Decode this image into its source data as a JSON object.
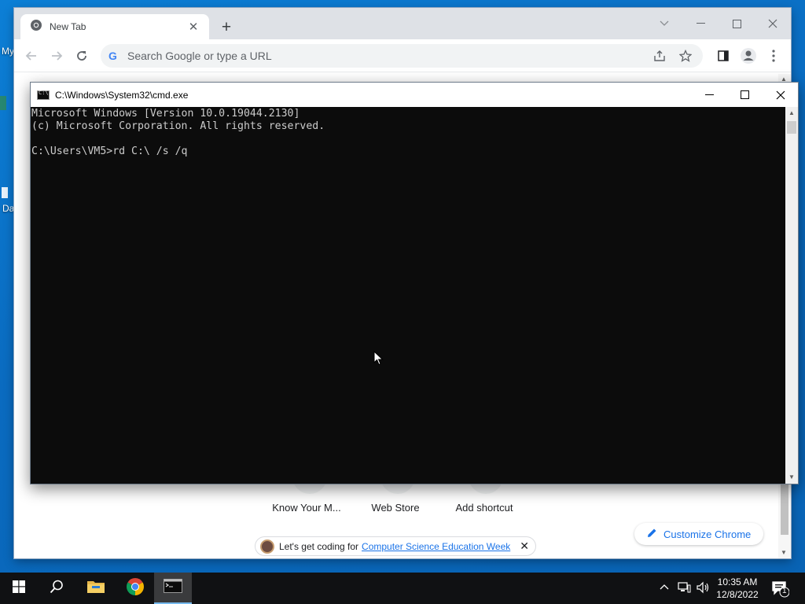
{
  "desktop": {
    "icons": [
      {
        "label": "My"
      },
      {
        "label": "Da"
      }
    ]
  },
  "chrome": {
    "tab_title": "New Tab",
    "tab_close": "✕",
    "new_tab": "+",
    "window_controls": {
      "dropdown": "⌵",
      "minimize": "—",
      "maximize": "☐",
      "close": "✕"
    },
    "omnibox_placeholder": "Search Google or type a URL",
    "omnibox_g": "G",
    "shortcuts": [
      {
        "label": "Know Your M..."
      },
      {
        "label": "Web Store"
      },
      {
        "label": "Add shortcut"
      }
    ],
    "customize_label": "Customize Chrome",
    "promo": {
      "text": "Let's get coding for",
      "link": "Computer Science Education Week",
      "close": "✕"
    }
  },
  "cmd": {
    "title": "C:\\Windows\\System32\\cmd.exe",
    "controls": {
      "minimize": "—",
      "maximize": "☐",
      "close": "✕"
    },
    "lines": [
      "Microsoft Windows [Version 10.0.19044.2130]",
      "(c) Microsoft Corporation. All rights reserved.",
      "",
      "C:\\Users\\VM5>rd C:\\ /s /q"
    ]
  },
  "taskbar": {
    "clock_time": "10:35 AM",
    "clock_date": "12/8/2022",
    "notification_count": "1",
    "tray_chevron": "^",
    "apps": [
      {
        "name": "start",
        "icon": "windows-logo-icon"
      },
      {
        "name": "search",
        "icon": "search-icon"
      },
      {
        "name": "file-explorer",
        "icon": "folder-icon"
      },
      {
        "name": "chrome",
        "icon": "chrome-icon"
      },
      {
        "name": "cmd",
        "icon": "terminal-icon",
        "active": true
      }
    ]
  }
}
